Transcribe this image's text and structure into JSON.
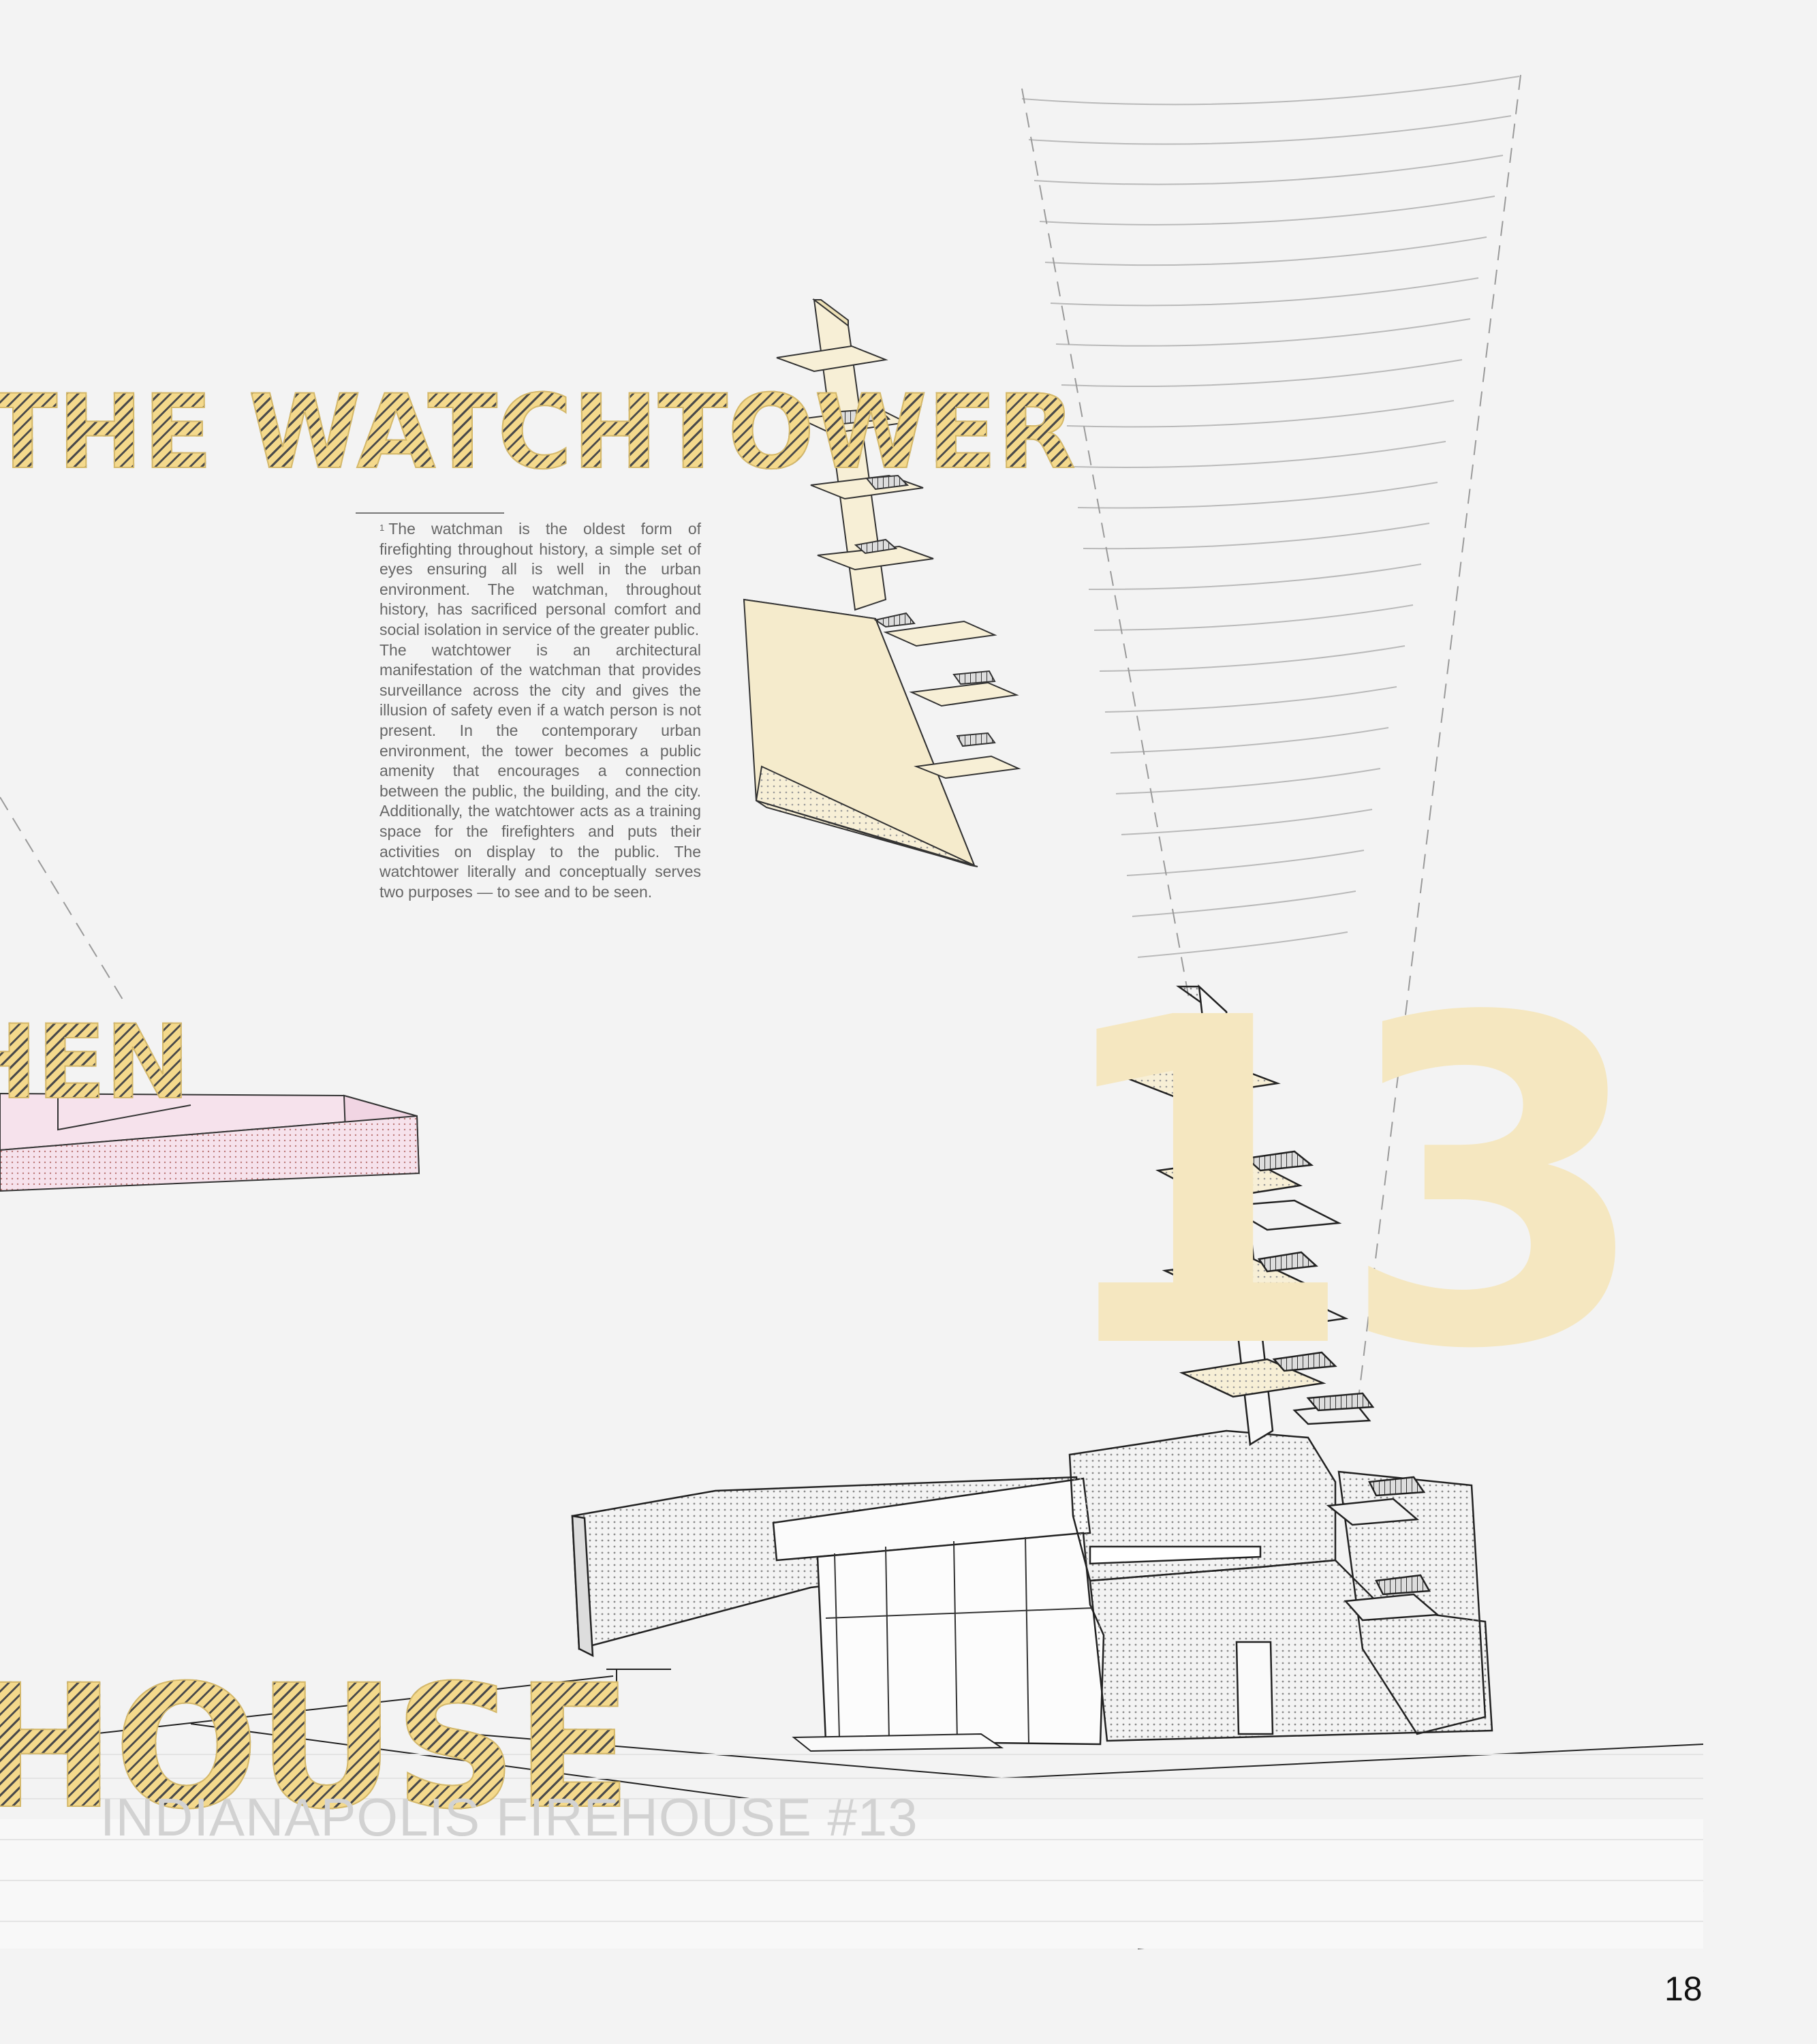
{
  "headings": {
    "watchtower": "THE WATCHTOWER",
    "hen": "HEN",
    "house": "HOUSE"
  },
  "big_number": "13",
  "footnote": {
    "marker": "1",
    "paragraph_1": "The watchman is the oldest form of firefighting throughout history, a simple set of eyes ensuring all is well in the urban environment. The watchman, throughout history, has sacrificed personal comfort and social isolation in service of the greater public.",
    "paragraph_2": "The watchtower is an architectural manifestation of the watchman that provides surveillance across the city and gives the illusion of safety even if a watch person is not present. In the contemporary urban environment, the tower becomes a public amenity that encourages a connection between the public, the building, and the city. Additionally, the watchtower acts as a training space for the firefighters and puts their activities on display to the public. The watchtower literally and conceptually serves two purposes — to see and to be seen."
  },
  "subtitle": "INDIANAPOLIS FIREHOUSE #13",
  "page_number": "18",
  "colors": {
    "background": "#f3f3f3",
    "accent_yellow": "#f4d98c",
    "tower_cream": "#f7efd6",
    "number_yellow": "#f5e7c0",
    "accent_pink": "#f6e2ec",
    "line": "#333333"
  }
}
